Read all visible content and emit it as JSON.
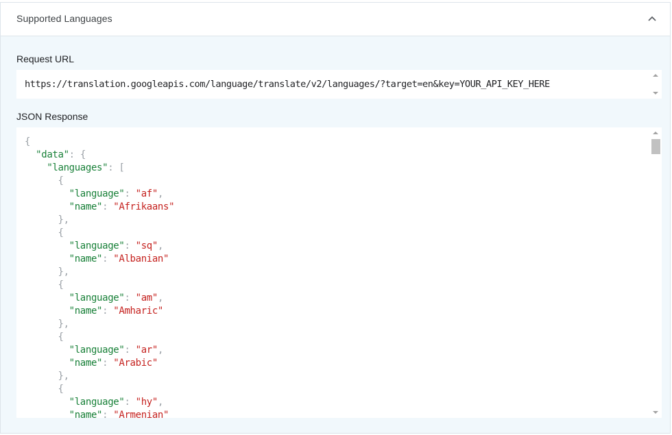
{
  "section": {
    "title": "Supported Languages",
    "collapse_icon": "chevron-up-icon"
  },
  "request": {
    "label": "Request URL",
    "url": "https://translation.googleapis.com/language/translate/v2/languages/?target=en&key=YOUR_API_KEY_HERE"
  },
  "response": {
    "label": "JSON Response",
    "lines": [
      {
        "indent": "",
        "parts": [
          {
            "t": "p",
            "v": "{"
          }
        ]
      },
      {
        "indent": "  ",
        "parts": [
          {
            "t": "k",
            "v": "\"data\""
          },
          {
            "t": "p",
            "v": ": {"
          }
        ]
      },
      {
        "indent": "    ",
        "parts": [
          {
            "t": "k",
            "v": "\"languages\""
          },
          {
            "t": "p",
            "v": ": ["
          }
        ]
      },
      {
        "indent": "      ",
        "parts": [
          {
            "t": "p",
            "v": "{"
          }
        ]
      },
      {
        "indent": "        ",
        "parts": [
          {
            "t": "k",
            "v": "\"language\""
          },
          {
            "t": "p",
            "v": ": "
          },
          {
            "t": "s",
            "v": "\"af\""
          },
          {
            "t": "p",
            "v": ","
          }
        ]
      },
      {
        "indent": "        ",
        "parts": [
          {
            "t": "k",
            "v": "\"name\""
          },
          {
            "t": "p",
            "v": ": "
          },
          {
            "t": "s",
            "v": "\"Afrikaans\""
          }
        ]
      },
      {
        "indent": "      ",
        "parts": [
          {
            "t": "p",
            "v": "},"
          }
        ]
      },
      {
        "indent": "      ",
        "parts": [
          {
            "t": "p",
            "v": "{"
          }
        ]
      },
      {
        "indent": "        ",
        "parts": [
          {
            "t": "k",
            "v": "\"language\""
          },
          {
            "t": "p",
            "v": ": "
          },
          {
            "t": "s",
            "v": "\"sq\""
          },
          {
            "t": "p",
            "v": ","
          }
        ]
      },
      {
        "indent": "        ",
        "parts": [
          {
            "t": "k",
            "v": "\"name\""
          },
          {
            "t": "p",
            "v": ": "
          },
          {
            "t": "s",
            "v": "\"Albanian\""
          }
        ]
      },
      {
        "indent": "      ",
        "parts": [
          {
            "t": "p",
            "v": "},"
          }
        ]
      },
      {
        "indent": "      ",
        "parts": [
          {
            "t": "p",
            "v": "{"
          }
        ]
      },
      {
        "indent": "        ",
        "parts": [
          {
            "t": "k",
            "v": "\"language\""
          },
          {
            "t": "p",
            "v": ": "
          },
          {
            "t": "s",
            "v": "\"am\""
          },
          {
            "t": "p",
            "v": ","
          }
        ]
      },
      {
        "indent": "        ",
        "parts": [
          {
            "t": "k",
            "v": "\"name\""
          },
          {
            "t": "p",
            "v": ": "
          },
          {
            "t": "s",
            "v": "\"Amharic\""
          }
        ]
      },
      {
        "indent": "      ",
        "parts": [
          {
            "t": "p",
            "v": "},"
          }
        ]
      },
      {
        "indent": "      ",
        "parts": [
          {
            "t": "p",
            "v": "{"
          }
        ]
      },
      {
        "indent": "        ",
        "parts": [
          {
            "t": "k",
            "v": "\"language\""
          },
          {
            "t": "p",
            "v": ": "
          },
          {
            "t": "s",
            "v": "\"ar\""
          },
          {
            "t": "p",
            "v": ","
          }
        ]
      },
      {
        "indent": "        ",
        "parts": [
          {
            "t": "k",
            "v": "\"name\""
          },
          {
            "t": "p",
            "v": ": "
          },
          {
            "t": "s",
            "v": "\"Arabic\""
          }
        ]
      },
      {
        "indent": "      ",
        "parts": [
          {
            "t": "p",
            "v": "},"
          }
        ]
      },
      {
        "indent": "      ",
        "parts": [
          {
            "t": "p",
            "v": "{"
          }
        ]
      },
      {
        "indent": "        ",
        "parts": [
          {
            "t": "k",
            "v": "\"language\""
          },
          {
            "t": "p",
            "v": ": "
          },
          {
            "t": "s",
            "v": "\"hy\""
          },
          {
            "t": "p",
            "v": ","
          }
        ]
      },
      {
        "indent": "        ",
        "parts": [
          {
            "t": "k",
            "v": "\"name\""
          },
          {
            "t": "p",
            "v": ": "
          },
          {
            "t": "s",
            "v": "\"Armenian\""
          }
        ]
      }
    ]
  },
  "colors": {
    "key": "#188038",
    "string": "#c5221f",
    "punct": "#9aa0a6",
    "panel_bg": "#f1f8fc"
  }
}
